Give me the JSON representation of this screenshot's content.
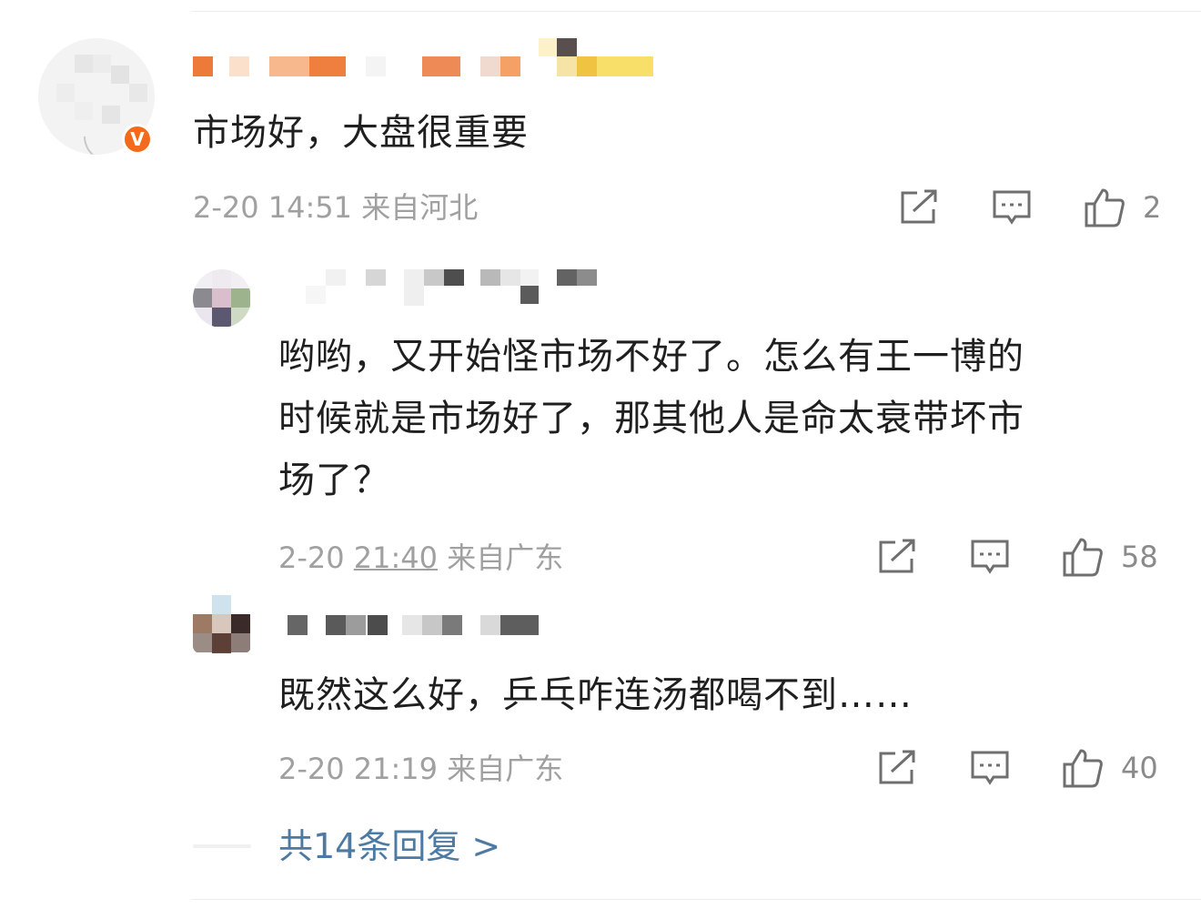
{
  "comment": {
    "text": "市场好，大盘很重要",
    "timestamp": "2-20 14:51",
    "location": "来自河北",
    "verified_badge": "V",
    "like_count": "2"
  },
  "replies": [
    {
      "text_lines": [
        "哟哟，又开始怪市场不好了。怎么有王一博的",
        "时候就是市场好了，那其他人是命太衰带坏市",
        "场了？"
      ],
      "timestamp_date": "2-20",
      "timestamp_time": "21:40",
      "location": "来自广东",
      "like_count": "58"
    },
    {
      "text_lines": [
        "既然这么好，乒乓咋连汤都喝不到……"
      ],
      "timestamp_date": "2-20",
      "timestamp_time": "21:19",
      "location": "来自广东",
      "like_count": "40"
    }
  ],
  "more_replies": "共14条回复 >",
  "icons": {
    "share": "share-icon",
    "comment": "comment-icon",
    "like": "thumbs-up-icon"
  },
  "colors": {
    "verified": "#f56a1a",
    "link": "#4d7aa3",
    "meta": "#a0a0a0",
    "icon": "#6f6f6f"
  }
}
